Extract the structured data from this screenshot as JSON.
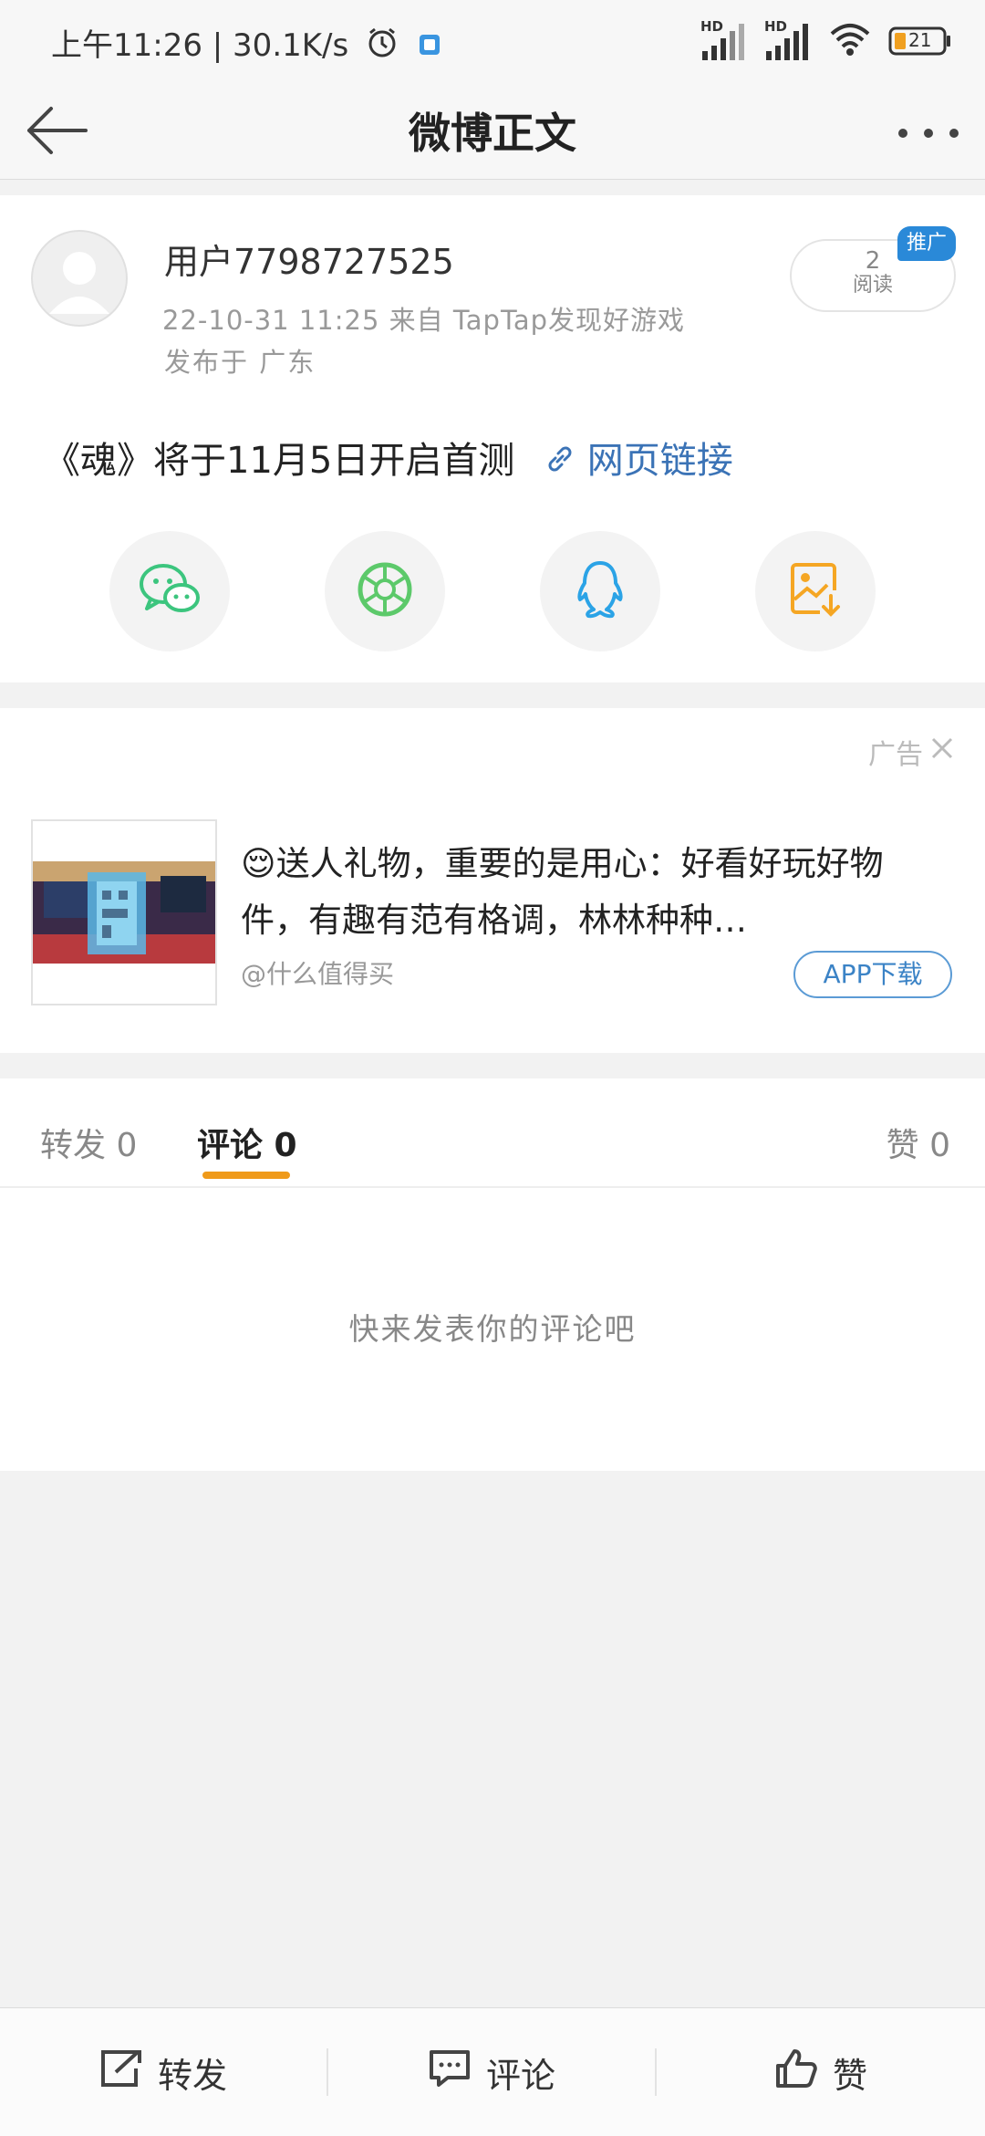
{
  "status_bar": {
    "left_text": "上午11:26 | 30.1K/s",
    "signal_label_1": "HD",
    "signal_label_2": "HD",
    "battery_text": "21"
  },
  "nav": {
    "title": "微博正文"
  },
  "post": {
    "username": "用户7798727525",
    "meta_line1": "22-10-31 11:25  来自 TapTap发现好游戏",
    "meta_line2": "发布于 广东",
    "read_count": "2",
    "read_label": "阅读",
    "promo_badge": "推广",
    "text": "《魂》将于11月5日开启首测",
    "link_text": "网页链接",
    "share_icons": [
      "wechat-icon",
      "moments-icon",
      "qq-icon",
      "save-image-icon"
    ]
  },
  "ad": {
    "label": "广告",
    "title": "😌送人礼物，重要的是用心：好看好玩好物件，有趣有范有格调，林林种种…",
    "source": "@什么值得买",
    "cta": "APP下载"
  },
  "tabs": {
    "repost": "转发 0",
    "comment": "评论 0",
    "like": "赞 0",
    "empty_text": "快来发表你的评论吧"
  },
  "bottom_bar": {
    "repost": "转发",
    "comment": "评论",
    "like": "赞"
  },
  "colors": {
    "accent_orange": "#ef9a1a",
    "link_blue": "#3b73b6",
    "promo_blue": "#2a89d8",
    "wechat_green": "#3cc57e",
    "moments_green": "#5cc96a",
    "qq_blue": "#2ba3e6",
    "save_orange": "#f5a623"
  }
}
